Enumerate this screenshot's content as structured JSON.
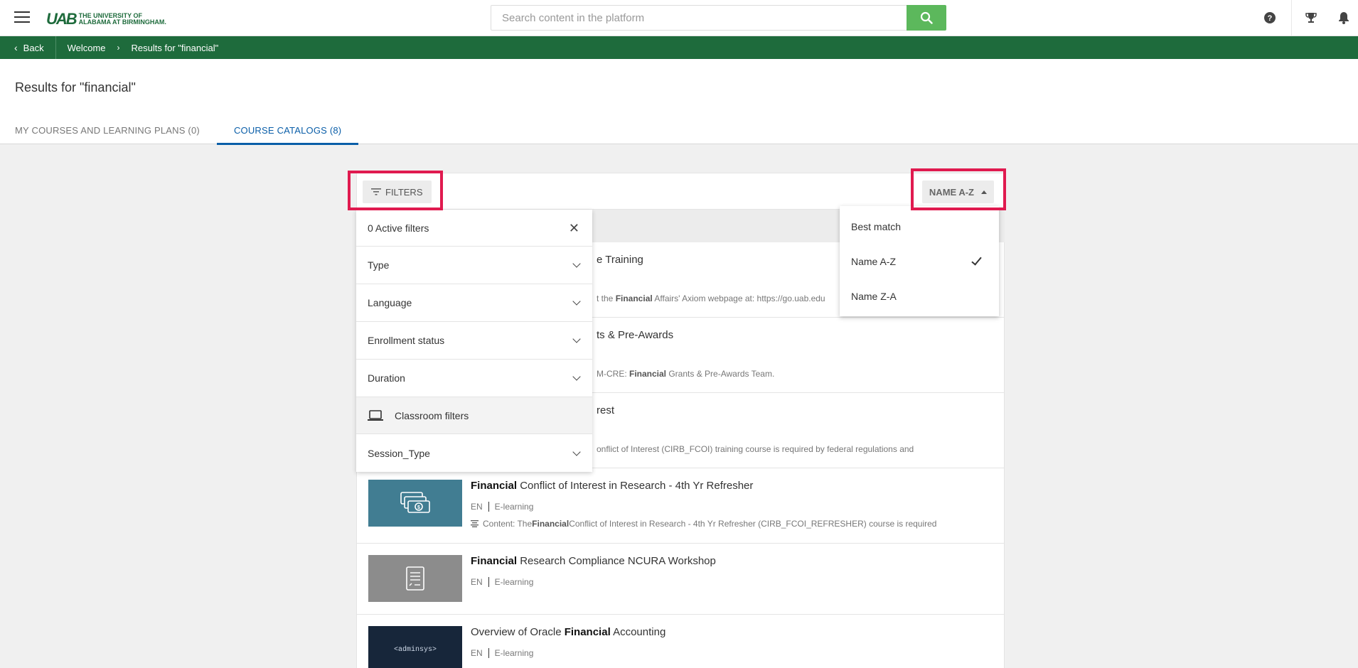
{
  "header": {
    "logo_mark": "UAB",
    "logo_line1": "The University of",
    "logo_line2": "Alabama at Birmingham.",
    "search_placeholder": "Search content in the platform"
  },
  "breadcrumb": {
    "back_label": "Back",
    "items": [
      "Welcome",
      "Results for \"financial\""
    ]
  },
  "page": {
    "title": "Results for \"financial\"",
    "tabs": [
      {
        "label": "My courses and learning plans (0)",
        "active": false
      },
      {
        "label": "Course catalogs (8)",
        "active": true
      }
    ]
  },
  "toolbar": {
    "filters_label": "Filters",
    "sort_label": "Name A-Z"
  },
  "filter_panel": {
    "active_label": "0 Active filters",
    "rows": [
      "Type",
      "Language",
      "Enrollment status",
      "Duration"
    ],
    "classroom_label": "Classroom filters",
    "session_label": "Session_Type"
  },
  "sort_menu": {
    "options": [
      "Best match",
      "Name A-Z",
      "Name Z-A"
    ],
    "selected": "Name A-Z"
  },
  "results": {
    "partial": [
      {
        "title_end": "e Training",
        "desc_prefix": "t the ",
        "desc_bold": "Financial",
        "desc_rest": " Affairs' Axiom webpage at: https://go.uab.edu"
      },
      {
        "title_end": "ts & Pre-Awards",
        "desc_prefix": "M-CRE: ",
        "desc_bold": "Financial",
        "desc_rest": " Grants & Pre-Awards Team."
      },
      {
        "title_end": "rest",
        "desc_prefix": "onflict of Interest (CIRB_FCOI) training course is required by federal regulations and",
        "desc_bold": "",
        "desc_rest": ""
      }
    ],
    "items": [
      {
        "title_bold": "Financial",
        "title_rest": " Conflict of Interest in Research - 4th Yr Refresher",
        "language": "EN",
        "type": "E-learning",
        "desc_prefix": "Content: The ",
        "desc_bold": "Financial",
        "desc_rest": " Conflict of Interest in Research - 4th Yr Refresher (CIRB_FCOI_REFRESHER) course is required",
        "thumb_icon": "money-icon"
      },
      {
        "title_bold": "Financial",
        "title_rest": " Research Compliance NCURA Workshop",
        "language": "EN",
        "type": "E-learning",
        "thumb_icon": "document-icon"
      },
      {
        "title_pre": "Overview of Oracle ",
        "title_bold": "Financial",
        "title_rest": " Accounting",
        "language": "EN",
        "type": "E-learning",
        "thumb_text": "<adminsys>"
      }
    ]
  },
  "colors": {
    "brand_green": "#1e6b3c",
    "search_green": "#5cb85c",
    "tab_active": "#0a5ea8",
    "highlight": "#e01a4f"
  }
}
